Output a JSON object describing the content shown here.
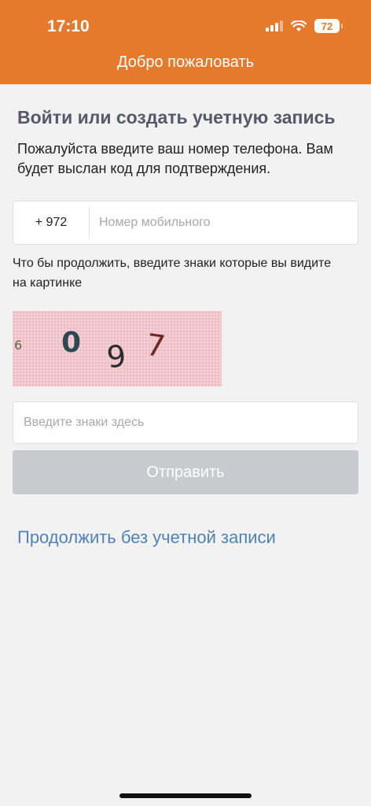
{
  "status_bar": {
    "time": "17:10",
    "battery": "72",
    "icons": [
      "signal-icon",
      "wifi-icon",
      "battery-icon"
    ]
  },
  "header": {
    "title": "Добро пожаловать",
    "background_color": "#e57a2c"
  },
  "login": {
    "heading": "Войти или создать учетную запись",
    "subtitle": "Пожалуйста введите ваш номер телефона. Вам будет выслан код для подтверждения."
  },
  "phone": {
    "country_code": "+ 972",
    "value": "",
    "placeholder": "Номер мобильного"
  },
  "captcha": {
    "hint": "Что бы продолжить, введите знаки которые вы видите на картинке",
    "chars": [
      "6",
      "0",
      "9",
      "7"
    ],
    "input_value": "",
    "input_placeholder": "Введите знаки здесь"
  },
  "actions": {
    "submit_label": "Отправить",
    "submit_enabled": false,
    "guest_link": "Продолжить без учетной записи",
    "link_color": "#4f83b7"
  }
}
